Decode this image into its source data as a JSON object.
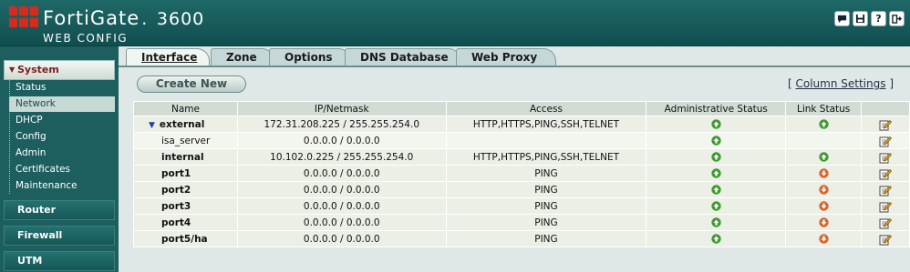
{
  "header": {
    "brand": "FortiGate",
    "model": "3600",
    "subtitle": "WEB CONFIG",
    "icons": [
      "chat-icon",
      "save-icon",
      "help-icon",
      "logout-icon"
    ]
  },
  "sidebar": {
    "menus": [
      {
        "label": "System",
        "active": true
      },
      {
        "label": "Router",
        "active": false
      },
      {
        "label": "Firewall",
        "active": false
      },
      {
        "label": "UTM",
        "active": false
      }
    ],
    "system_items": [
      "Status",
      "Network",
      "DHCP",
      "Config",
      "Admin",
      "Certificates",
      "Maintenance"
    ],
    "selected_item": "Network"
  },
  "tabs": [
    "Interface",
    "Zone",
    "Options",
    "DNS Database",
    "Web Proxy"
  ],
  "active_tab": "Interface",
  "content": {
    "create_button": "Create New",
    "column_settings": "Column Settings",
    "bracket_open": "[",
    "bracket_close": "]"
  },
  "table": {
    "headers": [
      "Name",
      "IP/Netmask",
      "Access",
      "Administrative Status",
      "Link Status",
      ""
    ],
    "rows": [
      {
        "name": "external",
        "ip": "172.31.208.225 / 255.255.254.0",
        "access": "HTTP,HTTPS,PING,SSH,TELNET",
        "admin": "up",
        "link": "up",
        "type": "parent"
      },
      {
        "name": "isa_server",
        "ip": "0.0.0.0 / 0.0.0.0",
        "access": "",
        "admin": "up",
        "link": "",
        "type": "sub"
      },
      {
        "name": "internal",
        "ip": "10.102.0.225 / 255.255.254.0",
        "access": "HTTP,HTTPS,PING,SSH,TELNET",
        "admin": "up",
        "link": "up",
        "type": "normal"
      },
      {
        "name": "port1",
        "ip": "0.0.0.0 / 0.0.0.0",
        "access": "PING",
        "admin": "up",
        "link": "down",
        "type": "normal"
      },
      {
        "name": "port2",
        "ip": "0.0.0.0 / 0.0.0.0",
        "access": "PING",
        "admin": "up",
        "link": "down",
        "type": "normal"
      },
      {
        "name": "port3",
        "ip": "0.0.0.0 / 0.0.0.0",
        "access": "PING",
        "admin": "up",
        "link": "down",
        "type": "normal"
      },
      {
        "name": "port4",
        "ip": "0.0.0.0 / 0.0.0.0",
        "access": "PING",
        "admin": "up",
        "link": "down",
        "type": "normal"
      },
      {
        "name": "port5/ha",
        "ip": "0.0.0.0 / 0.0.0.0",
        "access": "PING",
        "admin": "up",
        "link": "down",
        "type": "normal"
      }
    ]
  },
  "colors": {
    "status_up": "#3c9a2e",
    "status_down": "#d9642a",
    "header_bg": "#1a5f5f",
    "menu_active_text": "#7a1e1e"
  }
}
